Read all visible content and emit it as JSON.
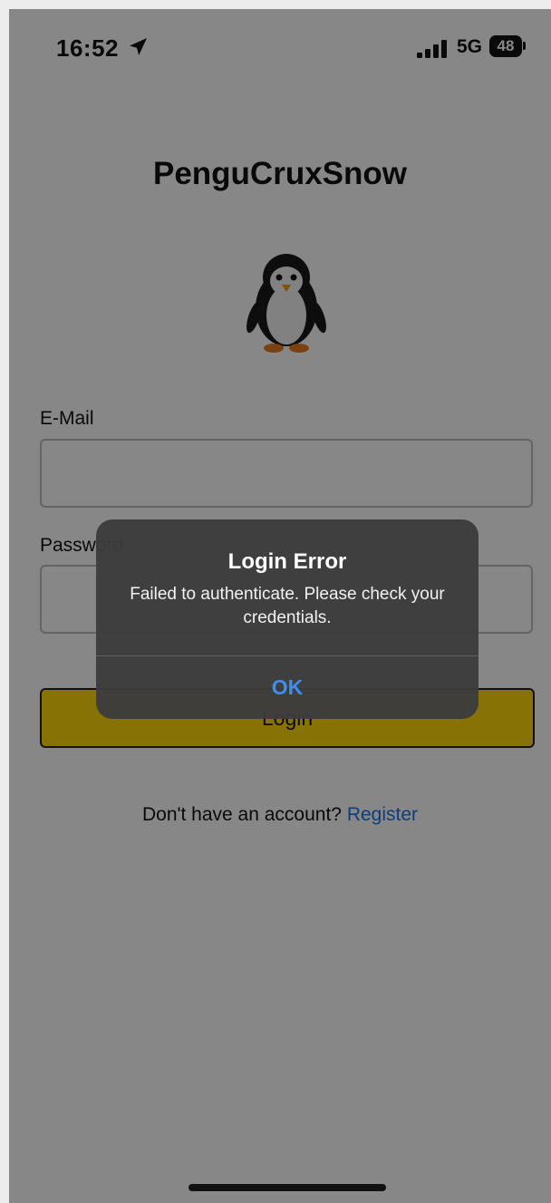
{
  "status_bar": {
    "time": "16:52",
    "network": "5G",
    "battery": "48"
  },
  "app": {
    "title": "PenguCruxSnow",
    "email_label": "E-Mail",
    "email_value": "",
    "password_label": "Password",
    "password_value": "",
    "login_label": "Login",
    "register_prompt": "Don't have an account?",
    "register_link": "Register"
  },
  "alert": {
    "title": "Login Error",
    "message": "Failed to authenticate. Please check your credentials.",
    "ok_label": "OK"
  },
  "colors": {
    "login_button": "#ffd80a",
    "link": "#1a73e8",
    "alert_ok": "#3d8ff5"
  },
  "icons": {
    "location": "location-arrow-icon",
    "signal": "cellular-signal-icon",
    "battery": "battery-icon",
    "logo": "penguin-icon"
  }
}
